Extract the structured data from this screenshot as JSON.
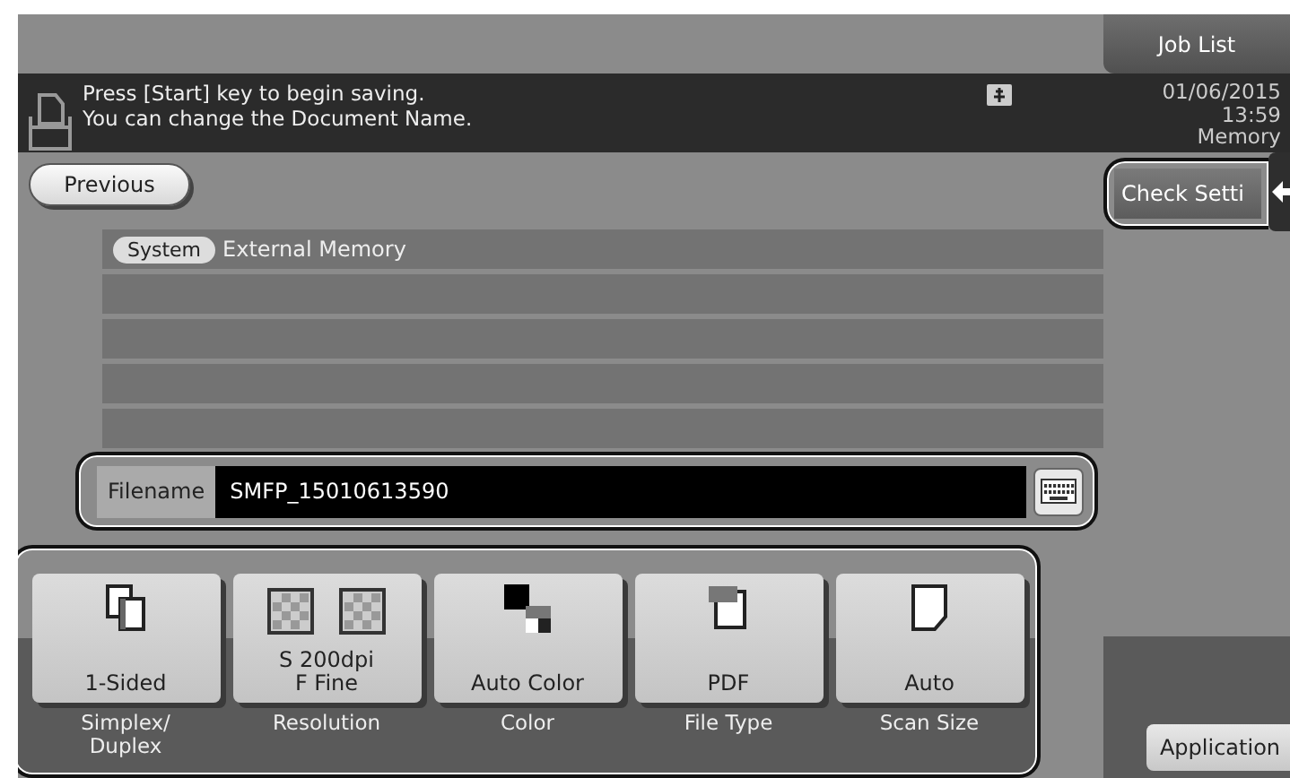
{
  "header": {
    "job_list": "Job List",
    "message": [
      "Press [Start] key to begin saving.",
      "You can change the Document Name."
    ],
    "date": "01/06/2015",
    "time": "13:59",
    "memory": "Memory"
  },
  "previous": "Previous",
  "check_settings": "Check Setti",
  "list": {
    "badge": "System",
    "text": "External Memory"
  },
  "filename": {
    "label": "Filename",
    "value": "SMFP_15010613590"
  },
  "functions": [
    {
      "kind": "simplex",
      "value": [
        "1-Sided"
      ],
      "label": [
        "Simplex/",
        "Duplex"
      ]
    },
    {
      "kind": "resolution",
      "value": [
        "S 200dpi",
        "F Fine"
      ],
      "label": [
        "Resolution"
      ]
    },
    {
      "kind": "color",
      "value": [
        "Auto Color"
      ],
      "label": [
        "Color"
      ]
    },
    {
      "kind": "filetype",
      "value": [
        "PDF"
      ],
      "label": [
        "File Type"
      ]
    },
    {
      "kind": "scansize",
      "value": [
        "Auto"
      ],
      "label": [
        "Scan Size"
      ]
    }
  ],
  "application": "Application"
}
